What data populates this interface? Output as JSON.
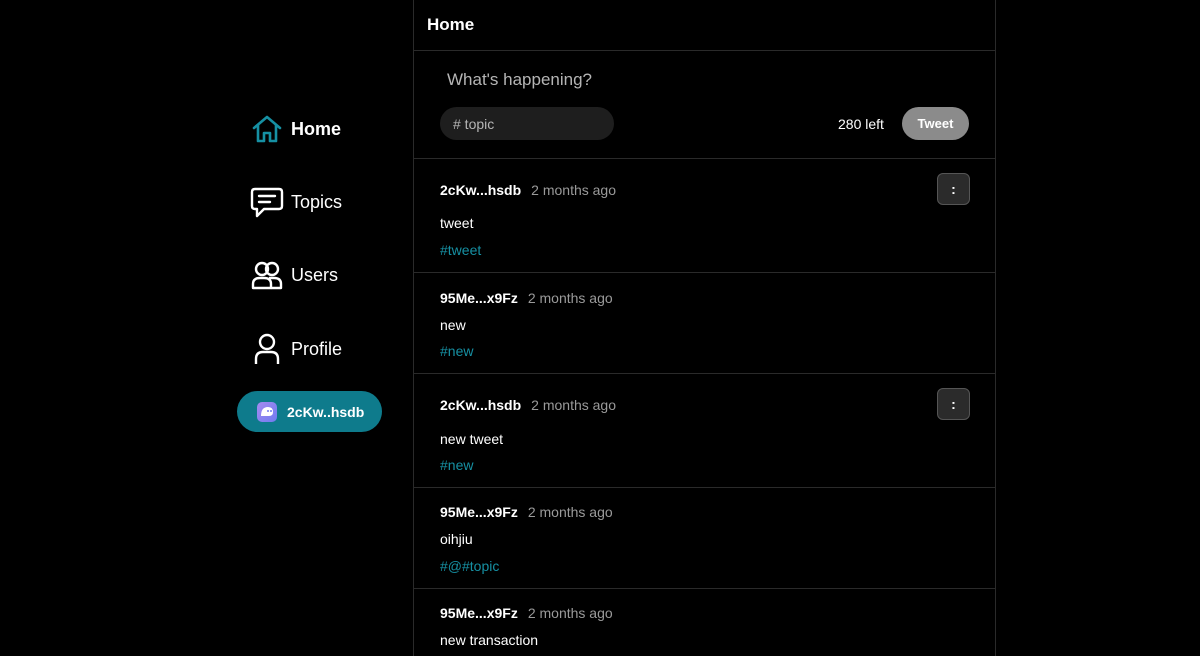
{
  "sidebar": {
    "items": [
      {
        "label": "Home",
        "icon": "home-icon",
        "active": true
      },
      {
        "label": "Topics",
        "icon": "chat-icon",
        "active": false
      },
      {
        "label": "Users",
        "icon": "users-icon",
        "active": false
      },
      {
        "label": "Profile",
        "icon": "user-icon",
        "active": false
      }
    ],
    "wallet": {
      "label": "2cKw..hsdb",
      "icon": "phantom-wallet-icon"
    }
  },
  "header": {
    "title": "Home"
  },
  "composer": {
    "placeholder": "What's happening?",
    "topic_placeholder": "# topic",
    "char_count": "280 left",
    "tweet_label": "Tweet"
  },
  "tweets": [
    {
      "author": "2cKw...hsdb",
      "time": "2 months ago",
      "content": "tweet",
      "tag": "#tweet",
      "has_menu": true
    },
    {
      "author": "95Me...x9Fz",
      "time": "2 months ago",
      "content": "new",
      "tag": "#new",
      "has_menu": false
    },
    {
      "author": "2cKw...hsdb",
      "time": "2 months ago",
      "content": "new tweet",
      "tag": "#new",
      "has_menu": true
    },
    {
      "author": "95Me...x9Fz",
      "time": "2 months ago",
      "content": "oihjiu",
      "tag": "#@#topic",
      "has_menu": false
    },
    {
      "author": "95Me...x9Fz",
      "time": "2 months ago",
      "content": "new transaction",
      "tag": "",
      "has_menu": false
    }
  ],
  "menu_label": ":",
  "colors": {
    "accent": "#0e7b8c",
    "tag": "#1690a3",
    "background": "#000000",
    "border": "#2a2a2a"
  }
}
